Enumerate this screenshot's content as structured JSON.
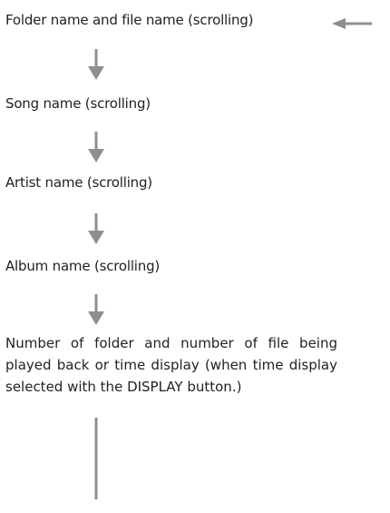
{
  "flow": {
    "steps": [
      "Folder name and file name (scrolling)",
      "Song name (scrolling)",
      "Artist name (scrolling)",
      "Album name (scrolling)",
      "Number of folder and number of file being played back or time display (when time display selected with the DISPLAY button.)"
    ],
    "arrow_color": "#8f8f8f"
  }
}
